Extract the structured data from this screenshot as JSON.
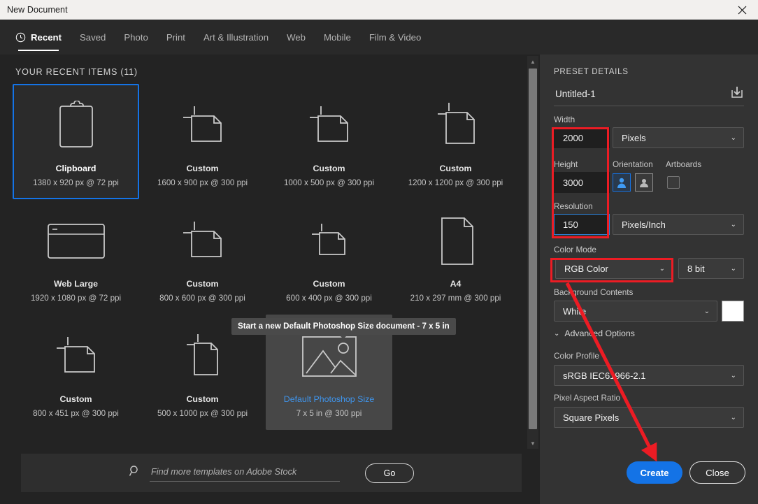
{
  "window": {
    "title": "New Document",
    "close_icon": "close-icon"
  },
  "tabs": [
    {
      "label": "Recent",
      "active": true,
      "icon": "clock-icon"
    },
    {
      "label": "Saved",
      "active": false
    },
    {
      "label": "Photo",
      "active": false
    },
    {
      "label": "Print",
      "active": false
    },
    {
      "label": "Art & Illustration",
      "active": false
    },
    {
      "label": "Web",
      "active": false
    },
    {
      "label": "Mobile",
      "active": false
    },
    {
      "label": "Film & Video",
      "active": false
    }
  ],
  "recent": {
    "heading": "YOUR RECENT ITEMS  (11)",
    "tooltip": "Start a new Default Photoshop Size document - 7 x 5 in",
    "items": [
      {
        "name": "Clipboard",
        "size": "1380 x 920 px @ 72 ppi",
        "thumb": "clipboard-icon",
        "state": "selected"
      },
      {
        "name": "Custom",
        "size": "1600 x 900 px @ 300 ppi",
        "thumb": "custom-doc-landscape-icon",
        "state": "normal"
      },
      {
        "name": "Custom",
        "size": "1000 x 500 px @ 300 ppi",
        "thumb": "custom-doc-landscape-icon",
        "state": "normal"
      },
      {
        "name": "Custom",
        "size": "1200 x 1200 px @ 300 ppi",
        "thumb": "custom-doc-square-icon",
        "state": "normal"
      },
      {
        "name": "Web Large",
        "size": "1920 x 1080 px @ 72 ppi",
        "thumb": "browser-window-icon",
        "state": "normal"
      },
      {
        "name": "Custom",
        "size": "800 x 600 px @ 300 ppi",
        "thumb": "custom-doc-landscape-icon",
        "state": "normal"
      },
      {
        "name": "Custom",
        "size": "600 x 400 px @ 300 ppi",
        "thumb": "custom-doc-landscape-icon",
        "state": "normal"
      },
      {
        "name": "A4",
        "size": "210 x 297 mm @ 300 ppi",
        "thumb": "page-portrait-icon",
        "state": "normal"
      },
      {
        "name": "Custom",
        "size": "800 x 451 px @ 300 ppi",
        "thumb": "custom-doc-landscape-icon",
        "state": "normal"
      },
      {
        "name": "Custom",
        "size": "500 x 1000 px @ 300 ppi",
        "thumb": "custom-doc-portrait-icon",
        "state": "normal"
      },
      {
        "name": "Default Photoshop Size",
        "size": "7 x 5 in @ 300 ppi",
        "thumb": "image-placeholder-icon",
        "state": "hovered"
      }
    ]
  },
  "stock_search": {
    "placeholder": "Find more templates on Adobe Stock",
    "value": "",
    "go_label": "Go",
    "icon": "search-icon"
  },
  "preset": {
    "heading": "PRESET DETAILS",
    "doc_name": "Untitled-1",
    "save_preset_icon": "save-preset-icon",
    "width": {
      "label": "Width",
      "value": "2000",
      "unit": "Pixels"
    },
    "height": {
      "label": "Height",
      "value": "3000"
    },
    "resolution": {
      "label": "Resolution",
      "value": "150",
      "unit": "Pixels/Inch"
    },
    "orientation": {
      "label": "Orientation",
      "portrait_icon": "portrait-orientation-icon",
      "landscape_icon": "landscape-orientation-icon",
      "selected": "portrait"
    },
    "artboards": {
      "label": "Artboards",
      "checked": false
    },
    "color_mode": {
      "label": "Color Mode",
      "value": "RGB Color",
      "depth": "8 bit"
    },
    "background_contents": {
      "label": "Background Contents",
      "value": "White",
      "swatch": "#ffffff"
    },
    "advanced_options": {
      "label": "Advanced Options",
      "expanded": true,
      "chevron": "chevron-down-icon"
    },
    "color_profile": {
      "label": "Color Profile",
      "value": "sRGB IEC61966-2.1"
    },
    "pixel_aspect_ratio": {
      "label": "Pixel Aspect Ratio",
      "value": "Square Pixels"
    }
  },
  "actions": {
    "create_label": "Create",
    "close_label": "Close"
  },
  "colors": {
    "accent_blue": "#1473e6",
    "annotation_red": "#ec1c24",
    "panel_bg": "#333333",
    "content_bg": "#232323",
    "titlebar_bg": "#f2f0ee"
  }
}
